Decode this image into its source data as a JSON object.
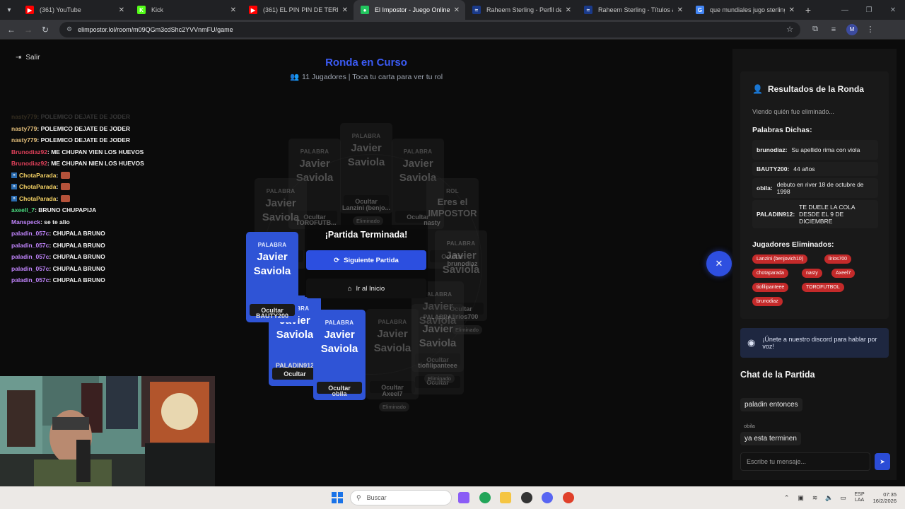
{
  "browser": {
    "tabs": [
      {
        "title": "(361) YouTube",
        "color": "#ff0000",
        "glyph": "▶",
        "active": false
      },
      {
        "title": "Kick",
        "color": "#53fc18",
        "glyph": "K",
        "active": false
      },
      {
        "title": "(361) EL PIN PIN DE TERNURA",
        "color": "#ff0000",
        "glyph": "▶",
        "active": false
      },
      {
        "title": "El Impostor - Juego Online Gra",
        "color": "#22c55e",
        "glyph": "●",
        "active": true
      },
      {
        "title": "Raheem Sterling - Perfil del jug",
        "color": "#1a3a8a",
        "glyph": "≈",
        "active": false
      },
      {
        "title": "Raheem Sterling - Títulos & Log",
        "color": "#1a3a8a",
        "glyph": "≈",
        "active": false
      },
      {
        "title": "que mundiales jugo sterling - B",
        "color": "#4285f4",
        "glyph": "G",
        "active": false
      }
    ],
    "url": "elimpostor.lol/room/m09QGm3cdShc2YVVnmFU/game",
    "profile_initial": "M"
  },
  "page": {
    "exit_label": "Salir",
    "round_title": "Ronda en Curso",
    "round_subtitle": "11 Jugadores | Toca tu carta para ver tu rol"
  },
  "stream_chat": [
    {
      "user": "nasty779",
      "msg": " : POLEMICO DEJATE DE JODER",
      "color": "#e5c07b",
      "faded": true,
      "badge": false,
      "emote": false
    },
    {
      "user": "nasty779",
      "msg": " : POLEMICO DEJATE DE JODER",
      "color": "#e5c07b",
      "faded": false,
      "badge": false,
      "emote": false
    },
    {
      "user": "nasty779",
      "msg": " : POLEMICO DEJATE DE JODER",
      "color": "#e5c07b",
      "faded": false,
      "badge": false,
      "emote": false
    },
    {
      "user": "Brunodiaz92",
      "msg": " : ME CHUPAN VIEN LOS HUEVOS",
      "color": "#e0405a",
      "faded": false,
      "badge": false,
      "emote": false
    },
    {
      "user": "Brunodiaz92",
      "msg": " : ME CHUPAN NIEN LOS HUEVOS",
      "color": "#e0405a",
      "faded": false,
      "badge": false,
      "emote": false
    },
    {
      "user": "ChotaParada",
      "msg": " :",
      "color": "#f6d365",
      "faded": false,
      "badge": true,
      "emote": true
    },
    {
      "user": "ChotaParada",
      "msg": " :",
      "color": "#f6d365",
      "faded": false,
      "badge": true,
      "emote": true
    },
    {
      "user": "ChotaParada",
      "msg": " :",
      "color": "#f6d365",
      "faded": false,
      "badge": true,
      "emote": true
    },
    {
      "user": "axeell_7",
      "msg": " : BRUNO CHUPAPIJA",
      "color": "#4ade80",
      "faded": false,
      "badge": false,
      "emote": false
    },
    {
      "user": "Manspeck",
      "msg": " : se te alio",
      "color": "#c084fc",
      "faded": false,
      "badge": false,
      "emote": false
    },
    {
      "user": "paladin_057c",
      "msg": " : CHUPALA BRUNO",
      "color": "#c084fc",
      "faded": false,
      "badge": false,
      "emote": false
    },
    {
      "user": "paladin_057c",
      "msg": " : CHUPALA BRUNO",
      "color": "#c084fc",
      "faded": false,
      "badge": false,
      "emote": false
    },
    {
      "user": "paladin_057c",
      "msg": " : CHUPALA BRUNO",
      "color": "#c084fc",
      "faded": false,
      "badge": false,
      "emote": false
    },
    {
      "user": "paladin_057c",
      "msg": " : CHUPALA BRUNO",
      "color": "#c084fc",
      "faded": false,
      "badge": false,
      "emote": false
    },
    {
      "user": "paladin_057c",
      "msg": " : CHUPALA BRUNO",
      "color": "#c084fc",
      "faded": false,
      "badge": false,
      "emote": false
    }
  ],
  "game": {
    "card_label": "PALABRA",
    "role_label": "ROL",
    "word": "Javier Saviola",
    "impostor_text": "Eres el IMPOSTOR",
    "hide_label": "Ocultar",
    "eliminated_label": "Eliminado",
    "players": {
      "p_top": "Lanzini (benjo...",
      "p_upper_left": "TOROFUTB...",
      "p_upper_right": "nasty",
      "p_right": "brunodiaz",
      "p_lower_right": "lirios700",
      "p_bottom_right": "tiofilipanteee",
      "p_bauty": "BAUTY200",
      "p_paladin": "PALADIN912",
      "p_obila": "obila",
      "p_axeel": "Axeel7"
    },
    "end_title": "¡Partida Terminada!",
    "next_button": "Siguiente Partida",
    "home_button": "Ir al Inicio"
  },
  "results": {
    "title": "Resultados de la Ronda",
    "subtitle": "Viendo quién fue eliminado...",
    "words_title": "Palabras Dichas:",
    "words": [
      {
        "user": "brunodiaz:",
        "text": "Su apellido rima con viola"
      },
      {
        "user": "BAUTY200:",
        "text": "44 años"
      },
      {
        "user": "obila:",
        "text": "debuto en river 18 de octubre de 1998"
      },
      {
        "user": "PALADIN912:",
        "text": "TE DUELE LA COLA DESDE EL 9 DE DICIEMBRE"
      }
    ],
    "eliminated_title": "Jugadores Eliminados:",
    "eliminated": [
      "Lanzini (benjovich10)",
      "lirios700",
      "chotaparada",
      "nasty",
      "Axeel7",
      "tiofilipanteee",
      "TOROFUTBOL",
      "brunodiaz"
    ]
  },
  "discord_text": "¡Únete a nuestro discord para hablar por voz!",
  "match_chat": {
    "title": "Chat de la Partida",
    "messages": [
      {
        "user": "",
        "text": "paladin entonces"
      },
      {
        "user": "obila",
        "text": "ya esta terminen"
      }
    ],
    "input_placeholder": "Escribe tu mensaje..."
  },
  "taskbar": {
    "search_placeholder": "Buscar",
    "lang_top": "ESP",
    "lang_bottom": "LAA",
    "time": "07:35",
    "date": "16/2/2026"
  },
  "colors": {
    "accent": "#2c4fe0",
    "danger": "#c42a2a",
    "background": "#0b0b0b"
  }
}
